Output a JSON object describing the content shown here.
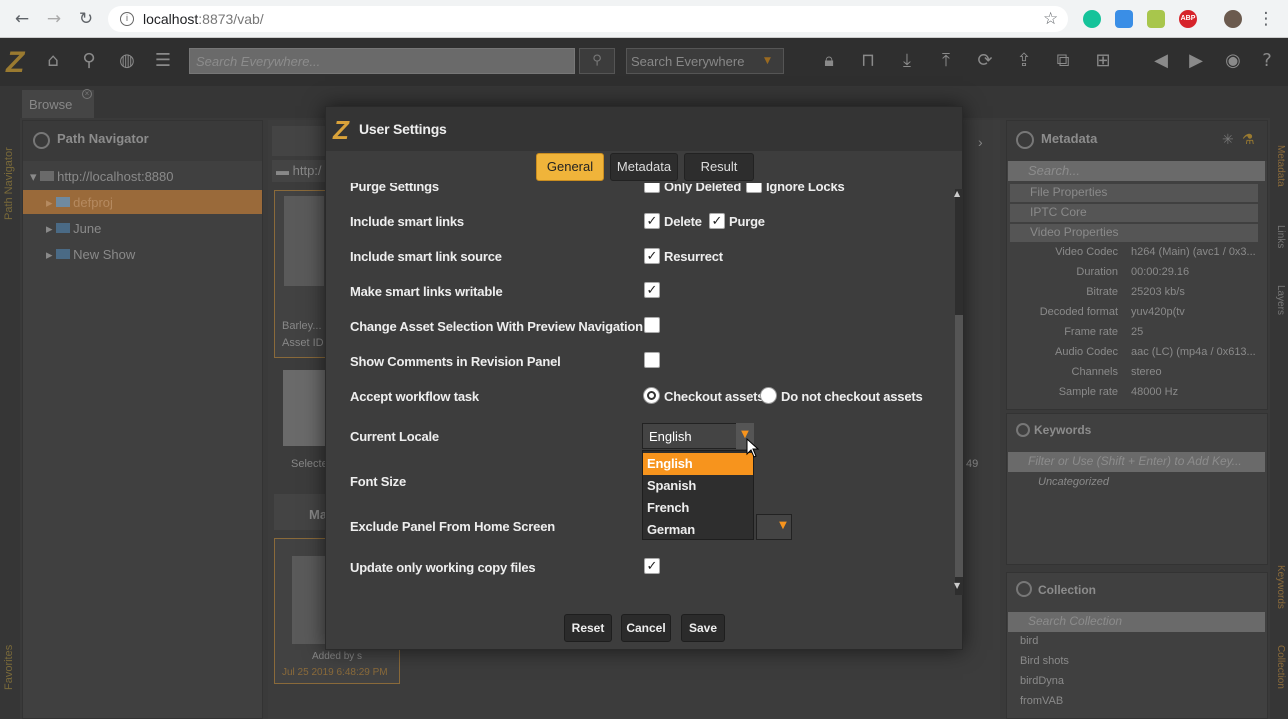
{
  "browser": {
    "url_host": "localhost",
    "url_rest": ":8873/vab/"
  },
  "app": {
    "search_placeholder": "Search Everywhere...",
    "search_scope": "Search Everywhere",
    "browse_tab": "Browse"
  },
  "left_panel": {
    "title": "Path Navigator",
    "items": [
      {
        "label": "http://localhost:8880"
      },
      {
        "label": "defproj"
      },
      {
        "label": "June"
      },
      {
        "label": "New Show"
      }
    ],
    "side_labels": [
      "Path Navigator",
      "Favorites"
    ]
  },
  "center": {
    "asset_name": "Barley...",
    "asset_id": "Asset ID",
    "selected": "Selecte",
    "count": "49",
    "manage": "Ma",
    "added_by": "Added by s",
    "added_date": "Jul 25 2019 6:48:29 PM"
  },
  "right_panel": {
    "metadata_title": "Metadata",
    "search_placeholder": "Search...",
    "sections": [
      "File Properties",
      "IPTC Core",
      "Video Properties"
    ],
    "properties": [
      {
        "key": "Video Codec",
        "value": "h264 (Main) (avc1 / 0x3..."
      },
      {
        "key": "Duration",
        "value": "00:00:29.16"
      },
      {
        "key": "Bitrate",
        "value": "25203 kb/s"
      },
      {
        "key": "Decoded format",
        "value": "yuv420p(tv"
      },
      {
        "key": "Frame rate",
        "value": "25"
      },
      {
        "key": "Audio Codec",
        "value": "aac (LC) (mp4a / 0x613..."
      },
      {
        "key": "Channels",
        "value": "stereo"
      },
      {
        "key": "Sample rate",
        "value": "48000 Hz"
      }
    ],
    "keywords_title": "Keywords",
    "keywords_placeholder": "Filter or Use (Shift + Enter) to Add Key...",
    "uncategorized": "Uncategorized",
    "collection_title": "Collection",
    "collection_placeholder": "Search Collection",
    "collections": [
      "bird",
      "Bird shots",
      "birdDyna",
      "fromVAB"
    ],
    "side_labels": [
      "Metadata",
      "Links",
      "Layers",
      "Keywords",
      "Collection"
    ]
  },
  "modal": {
    "title": "User Settings",
    "tabs": [
      {
        "label": "General",
        "active": true
      },
      {
        "label": "Metadata",
        "active": false
      },
      {
        "label": "Result",
        "active": false
      }
    ],
    "rows": {
      "purge_settings": "Purge Settings",
      "purge_only_deleted": "Only Deleted",
      "purge_ignore_locks": "Ignore Locks",
      "include_smart_links": "Include smart links",
      "delete": "Delete",
      "purge": "Purge",
      "include_smart_link_source": "Include smart link source",
      "resurrect": "Resurrect",
      "make_smart_links_writable": "Make smart links writable",
      "change_asset_selection": "Change Asset Selection With Preview Navigation",
      "show_comments": "Show Comments in Revision Panel",
      "accept_workflow_task": "Accept workflow task",
      "checkout_assets": "Checkout assets",
      "do_not_checkout": "Do not checkout assets",
      "current_locale": "Current Locale",
      "font_size": "Font Size",
      "exclude_panel": "Exclude Panel From Home Screen",
      "update_working_copy": "Update only working copy files"
    },
    "locale": {
      "selected": "English",
      "options": [
        "English",
        "Spanish",
        "French",
        "German"
      ]
    },
    "buttons": {
      "reset": "Reset",
      "cancel": "Cancel",
      "save": "Save"
    }
  },
  "colors": {
    "accent": "#f7941d",
    "tab_active": "#f0b43a",
    "modal_bg": "#3d3d3d"
  }
}
